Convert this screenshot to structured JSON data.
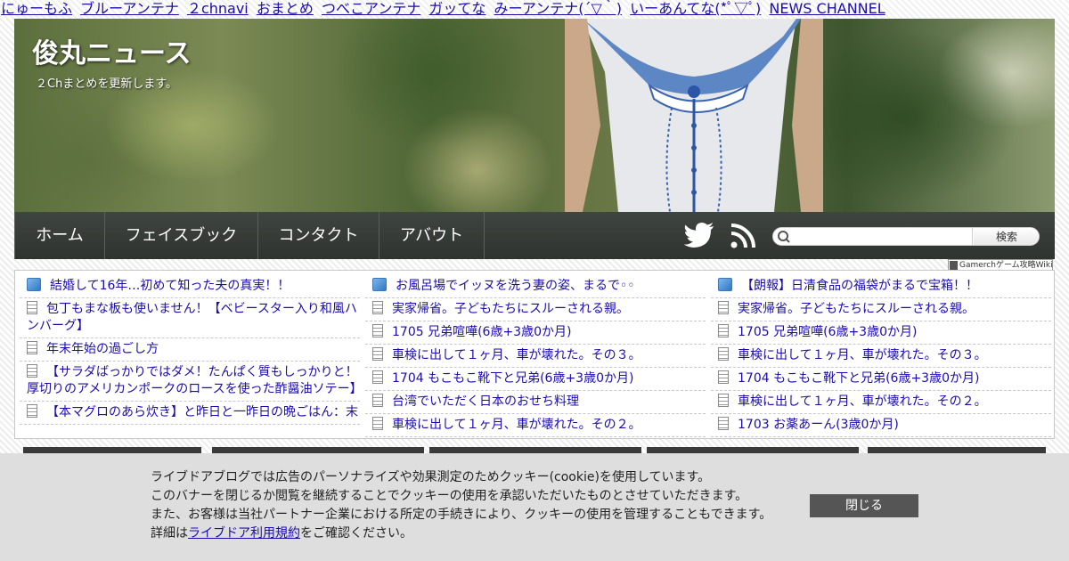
{
  "topbar": {
    "links": [
      "にゅーもふ",
      "ブルーアンテナ",
      "２chnavi",
      "おまとめ",
      "つべこアンテナ",
      "ガッてな",
      "みーアンテナ(´▽｀)",
      "いーあんてな(*ﾟ▽ﾟ)",
      "NEWS CHANNEL"
    ]
  },
  "header": {
    "title": "俊丸ニュース",
    "description": "２Chまとめを更新します。"
  },
  "nav": {
    "items": [
      "ホーム",
      "フェイスブック",
      "コンタクト",
      "アバウト"
    ],
    "twitter_icon": "twitter-icon",
    "rss_icon": "rss-icon",
    "search": {
      "placeholder": "",
      "button_label": "検索"
    }
  },
  "wiki_badge": "Gamerchゲーム攻略Wiki",
  "antenna": {
    "col1": [
      {
        "icon": "blog",
        "text": "結婚して16年…初めて知った夫の真実！！"
      },
      {
        "icon": "doc",
        "text": "包丁もまな板も使いません！【ベビースター入り和風ハンバーグ】"
      },
      {
        "icon": "doc",
        "text": "年末年始の過ごし方"
      },
      {
        "icon": "doc",
        "text": "【サラダばっかりではダメ！たんぱく質もしっかりと！厚切りのアメリカンポークのロースを使った酢醤油ソテー】"
      },
      {
        "icon": "doc",
        "text": "【本マグロのあら炊き】と昨日と一昨日の晩ごはん：末"
      }
    ],
    "col2": [
      {
        "icon": "blog",
        "text": "お風呂場でイッヌを洗う妻の姿、まるで◦◦"
      },
      {
        "icon": "doc",
        "text": "実家帰省。子どもたちにスルーされる親。"
      },
      {
        "icon": "doc",
        "text": "1705 兄弟喧嘩(6歳+3歳0か月)"
      },
      {
        "icon": "doc",
        "text": "車検に出して１ヶ月、車が壊れた。その３。"
      },
      {
        "icon": "doc",
        "text": "1704 もこもこ靴下と兄弟(6歳+3歳0か月)"
      },
      {
        "icon": "doc",
        "text": "台湾でいただく日本のおせち料理"
      },
      {
        "icon": "doc",
        "text": "車検に出して１ヶ月、車が壊れた。その２。"
      }
    ],
    "col3": [
      {
        "icon": "blog",
        "text": "【朗報】日清食品の福袋がまるで宝箱！！"
      },
      {
        "icon": "doc",
        "text": "実家帰省。子どもたちにスルーされる親。"
      },
      {
        "icon": "doc",
        "text": "1705 兄弟喧嘩(6歳+3歳0か月)"
      },
      {
        "icon": "doc",
        "text": "車検に出して１ヶ月、車が壊れた。その３。"
      },
      {
        "icon": "doc",
        "text": "1704 もこもこ靴下と兄弟(6歳+3歳0か月)"
      },
      {
        "icon": "doc",
        "text": "車検に出して１ヶ月、車が壊れた。その２。"
      },
      {
        "icon": "doc",
        "text": "1703 お薬あーん(3歳0か月)"
      }
    ]
  },
  "cookie": {
    "line1": "ライブドアブログでは広告のパーソナライズや効果測定のためクッキー(cookie)を使用しています。",
    "line2": "このバナーを閉じるか閲覧を継続することでクッキーの使用を承認いただいたものとさせていただきます。",
    "line3": "また、お客様は当社パートナー企業における所定の手続きにより、クッキーの使用を管理することもできます。",
    "line4_prefix": "詳細は",
    "line4_link": "ライブドア利用規約",
    "line4_suffix": "をご確認ください。",
    "close_label": "閉じる"
  }
}
